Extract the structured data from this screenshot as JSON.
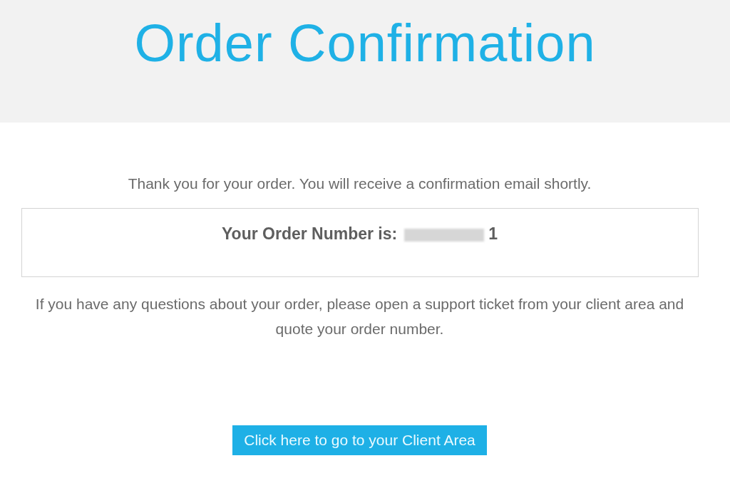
{
  "header": {
    "title": "Order Confirmation"
  },
  "thank_you": "Thank you for your order. You will receive a confirmation email shortly.",
  "order_box": {
    "label": "Your Order Number is:",
    "number_tail": "1"
  },
  "help_text": "If you have any questions about your order, please open a support ticket from your client area and quote your order number.",
  "button": {
    "label": "Click here to go to your Client Area"
  }
}
